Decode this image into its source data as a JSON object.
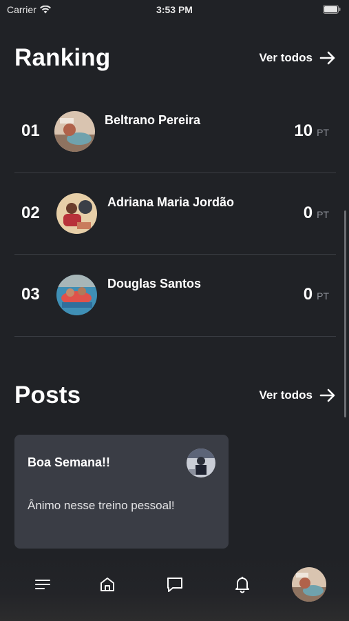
{
  "status_bar": {
    "carrier": "Carrier",
    "time": "3:53 PM"
  },
  "ranking": {
    "title": "Ranking",
    "see_all": "Ver todos",
    "entries": [
      {
        "position": "01",
        "name": "Beltrano Pereira",
        "score": "10",
        "unit": "PT"
      },
      {
        "position": "02",
        "name": "Adriana Maria Jordão",
        "score": "0",
        "unit": "PT"
      },
      {
        "position": "03",
        "name": "Douglas Santos",
        "score": "0",
        "unit": "PT"
      }
    ]
  },
  "posts": {
    "title": "Posts",
    "see_all": "Ver todos",
    "items": [
      {
        "title": "Boa Semana!!",
        "body": "Ânimo nesse treino pessoal!"
      }
    ]
  },
  "tab_bar": {
    "items": [
      "menu-icon",
      "home-icon",
      "chat-icon",
      "bell-icon",
      "profile-avatar"
    ]
  },
  "colors": {
    "background": "#202226",
    "card": "#3a3d45",
    "divider": "#3a3d43",
    "muted": "#8d9098"
  }
}
